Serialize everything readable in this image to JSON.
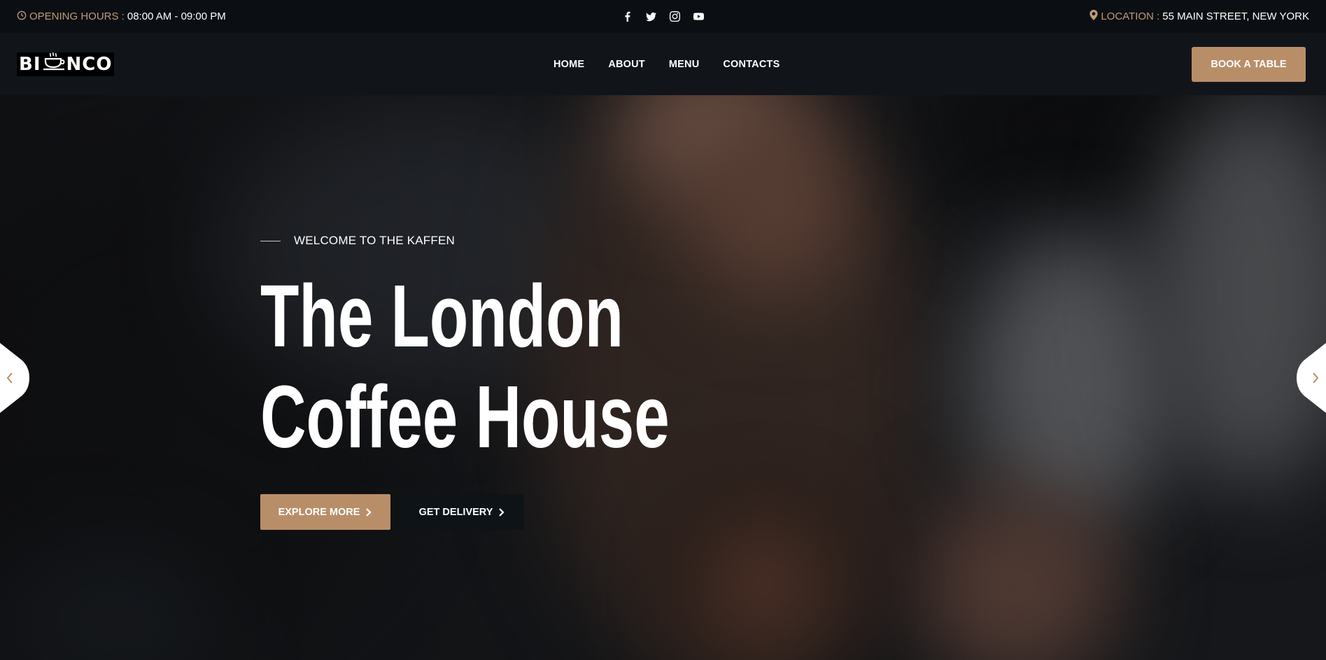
{
  "topbar": {
    "hours_label": "OPENING HOURS :",
    "hours_value": "08:00 AM - 09:00 PM",
    "location_label": "LOCATION :",
    "location_value": "55 MAIN STREET, NEW YORK",
    "social_icons": [
      "facebook-icon",
      "twitter-icon",
      "instagram-icon",
      "youtube-icon"
    ]
  },
  "header": {
    "logo_left": "BI",
    "logo_right": "NCO",
    "nav": [
      "HOME",
      "ABOUT",
      "MENU",
      "CONTACTS"
    ],
    "book_label": "BOOK A TABLE"
  },
  "hero": {
    "eyebrow": "WELCOME TO THE KAFFEN",
    "title_line1": "The London",
    "title_line2": "Coffee House",
    "explore_label": "EXPLORE MORE",
    "delivery_label": "GET DELIVERY"
  },
  "colors": {
    "accent": "#b88e69",
    "topbar_bg": "#0b0f13",
    "header_bg": "#11151a",
    "dark_button": "#0e1318"
  }
}
